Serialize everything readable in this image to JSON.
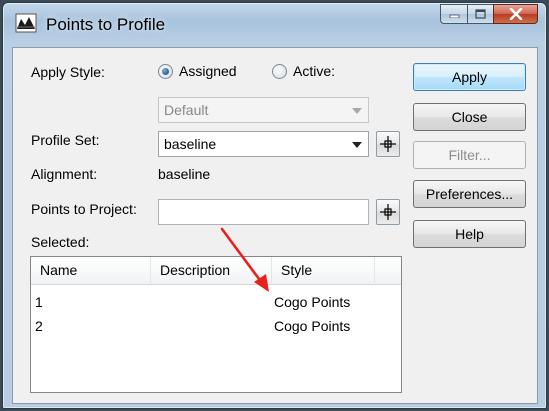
{
  "window": {
    "title": "Points to Profile"
  },
  "form": {
    "apply_style_label": "Apply Style:",
    "apply_style_options": [
      {
        "label": "Assigned",
        "selected": true
      },
      {
        "label": "Active:",
        "selected": false
      }
    ],
    "style_combo_value": "Default",
    "profile_set_label": "Profile Set:",
    "profile_set_value": "baseline",
    "alignment_label": "Alignment:",
    "alignment_value": "baseline",
    "points_to_project_label": "Points to Project:",
    "points_to_project_value": "",
    "selected_label": "Selected:"
  },
  "buttons": {
    "apply": "Apply",
    "close": "Close",
    "filter": "Filter...",
    "preferences": "Preferences...",
    "help": "Help"
  },
  "table": {
    "columns": [
      "Name",
      "Description",
      "Style"
    ],
    "rows": [
      {
        "name": "1",
        "description": "",
        "style": "Cogo Points"
      },
      {
        "name": "2",
        "description": "",
        "style": "Cogo Points"
      }
    ]
  },
  "icons": {
    "app": "profile-icon",
    "pick": "crosshair-icon",
    "minimize": "minimize-icon",
    "maximize": "maximize-icon",
    "close": "close-icon",
    "annotation": "red-arrow-icon"
  },
  "colors": {
    "annotation_arrow": "#e8211c",
    "default_button_border": "#3c7fb1"
  }
}
